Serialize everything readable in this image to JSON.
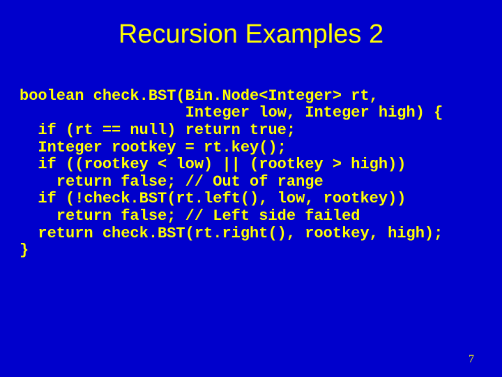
{
  "slide": {
    "title": "Recursion Examples 2",
    "page_number": "7"
  },
  "code": {
    "l0": "boolean check.BST(Bin.Node<Integer> rt,",
    "l1": "                  Integer low, Integer high) {",
    "l2": "  if (rt == null) return true;",
    "l3": "  Integer rootkey = rt.key();",
    "l4": "  if ((rootkey < low) || (rootkey > high))",
    "l5": "    return false; // Out of range",
    "l6": "  if (!check.BST(rt.left(), low, rootkey))",
    "l7": "    return false; // Left side failed",
    "l8": "  return check.BST(rt.right(), rootkey, high);",
    "l9": "}"
  }
}
